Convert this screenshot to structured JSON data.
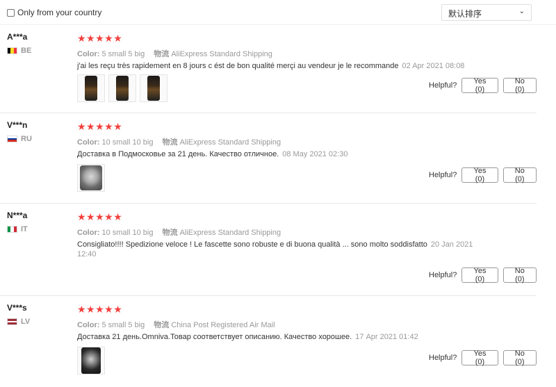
{
  "filter": {
    "country_label": "Only from your country",
    "sort_value": "默认排序"
  },
  "reviews": [
    {
      "user": "A***a",
      "country": "BE",
      "stars": "★★★★★",
      "color_label": "Color:",
      "color_value": "5 small 5 big",
      "ship_label": "物流",
      "ship_value": "AliExpress Standard Shipping",
      "text": "j'ai les reçu très rapidement en 8 jours c ést de bon qualité merçi au vendeur je le recommande",
      "date": "02 Apr 2021 08:08",
      "helpful_label": "Helpful?",
      "yes_label": "Yes (0)",
      "no_label": "No (0)"
    },
    {
      "user": "V***n",
      "country": "RU",
      "stars": "★★★★★",
      "color_label": "Color:",
      "color_value": "10 small 10 big",
      "ship_label": "物流",
      "ship_value": "AliExpress Standard Shipping",
      "text": "Доставка в Подмосковье за 21 день. Качество отличное.",
      "date": "08 May 2021 02:30",
      "helpful_label": "Helpful?",
      "yes_label": "Yes (0)",
      "no_label": "No (0)"
    },
    {
      "user": "N***a",
      "country": "IT",
      "stars": "★★★★★",
      "color_label": "Color:",
      "color_value": "10 small 10 big",
      "ship_label": "物流",
      "ship_value": "AliExpress Standard Shipping",
      "text": "Consigliato!!!! Spedizione veloce ! Le fascette sono robuste e di buona qualità ... sono molto soddisfatto",
      "date": "20 Jan 2021 12:40",
      "helpful_label": "Helpful?",
      "yes_label": "Yes (0)",
      "no_label": "No (0)"
    },
    {
      "user": "V***s",
      "country": "LV",
      "stars": "★★★★★",
      "color_label": "Color:",
      "color_value": "5 small 5 big",
      "ship_label": "物流",
      "ship_value": "China Post Registered Air Mail",
      "text": "Доставка 21 день.Omniva.Товар соответствует описанию. Качество хорошее.",
      "date": "17 Apr 2021 01:42",
      "helpful_label": "Helpful?",
      "yes_label": "Yes (0)",
      "no_label": "No (0)"
    }
  ]
}
